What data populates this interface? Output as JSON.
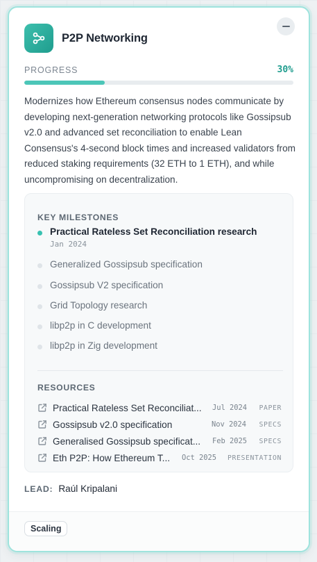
{
  "card": {
    "title": "P2P Networking",
    "icon": "network-nodes-icon",
    "accent_color": "#1f9d8e"
  },
  "progress": {
    "label": "PROGRESS",
    "value_text": "30%",
    "fraction": 0.3
  },
  "description": "Modernizes how Ethereum consensus nodes communicate by developing next-generation networking protocols like Gossipsub v2.0 and advanced set reconciliation to enable Lean Consensus's 4-second block times and increased validators from reduced staking requirements (32 ETH to 1 ETH), and while uncompromising on decentralization.",
  "milestones": {
    "title": "KEY MILESTONES",
    "items": [
      {
        "label": "Practical Rateless Set Reconciliation research",
        "date": "Jan 2024",
        "active": true
      },
      {
        "label": "Generalized Gossipsub specification",
        "date": "",
        "active": false
      },
      {
        "label": "Gossipsub V2 specification",
        "date": "",
        "active": false
      },
      {
        "label": "Grid Topology research",
        "date": "",
        "active": false
      },
      {
        "label": "libp2p in C development",
        "date": "",
        "active": false
      },
      {
        "label": "libp2p in Zig development",
        "date": "",
        "active": false
      }
    ]
  },
  "resources": {
    "title": "RESOURCES",
    "items": [
      {
        "title": "Practical Rateless Set Reconciliat...",
        "date": "Jul 2024",
        "type": "PAPER"
      },
      {
        "title": "Gossipsub v2.0 specification",
        "date": "Nov 2024",
        "type": "SPECS"
      },
      {
        "title": "Generalised Gossipsub specificat...",
        "date": "Feb 2025",
        "type": "SPECS"
      },
      {
        "title": "Eth P2P: How Ethereum T...",
        "date": "Oct 2025",
        "type": "PRESENTATION"
      }
    ]
  },
  "lead": {
    "label": "LEAD:",
    "name": "Raúl Kripalani"
  },
  "tags": [
    "Scaling"
  ]
}
